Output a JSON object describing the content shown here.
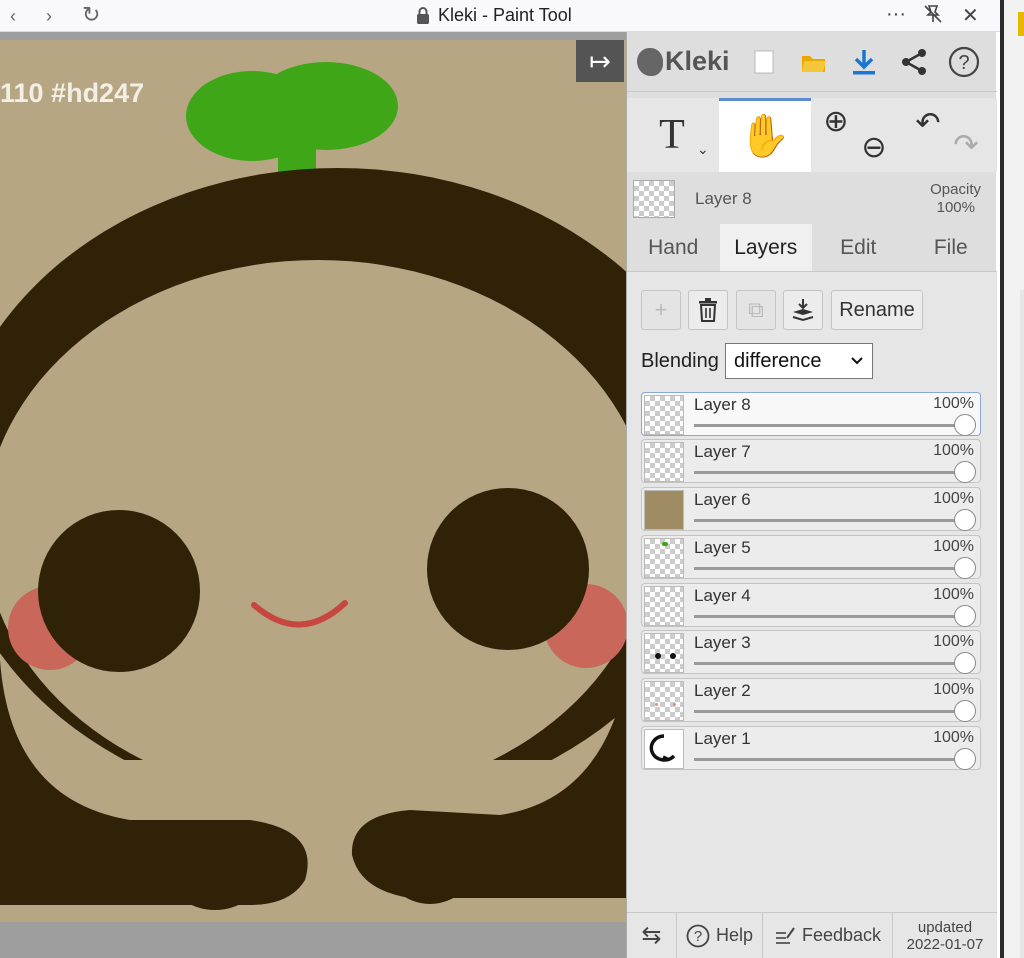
{
  "browser": {
    "title": "Kleki - Paint Tool",
    "back_icon": "‹",
    "forward_icon": "›",
    "reload_icon": "↻",
    "more_icon": "···",
    "close_icon": "✕"
  },
  "canvas": {
    "overlay_text": "110 #hd247",
    "collapse_icon": "↦",
    "colors": {
      "background": "#b6a684",
      "outline": "#2f2206",
      "sprout": "#3fa617",
      "cheek": "#c9675a",
      "mouth": "#c84640"
    }
  },
  "panel": {
    "logo_text": "Kleki",
    "top_buttons": [
      "new-file",
      "open-folder",
      "download",
      "share",
      "help"
    ],
    "tools": {
      "text_tool": "T",
      "hand_tool": "✋",
      "zoom_in": "⊕",
      "zoom_out": "⊖",
      "undo": "↶",
      "redo": "↷"
    },
    "active_layer": {
      "name": "Layer 8",
      "opacity_label": "Opacity",
      "opacity_value": "100%"
    },
    "tabs": [
      "Hand",
      "Layers",
      "Edit",
      "File"
    ],
    "active_tab": "Layers",
    "layer_actions": {
      "add": "+",
      "delete": "🗑",
      "duplicate": "⧉",
      "merge": "⤓",
      "rename": "Rename"
    },
    "blending_label": "Blending",
    "blending_value": "difference",
    "layers": [
      {
        "name": "Layer 8",
        "opacity": "100%",
        "active": true
      },
      {
        "name": "Layer 7",
        "opacity": "100%"
      },
      {
        "name": "Layer 6",
        "opacity": "100%"
      },
      {
        "name": "Layer 5",
        "opacity": "100%"
      },
      {
        "name": "Layer 4",
        "opacity": "100%"
      },
      {
        "name": "Layer 3",
        "opacity": "100%"
      },
      {
        "name": "Layer 2",
        "opacity": "100%"
      },
      {
        "name": "Layer 1",
        "opacity": "100%"
      }
    ],
    "bottom": {
      "swap_icon": "⇆",
      "help": "Help",
      "feedback": "Feedback",
      "updated_label": "updated",
      "updated_date": "2022-01-07"
    }
  }
}
